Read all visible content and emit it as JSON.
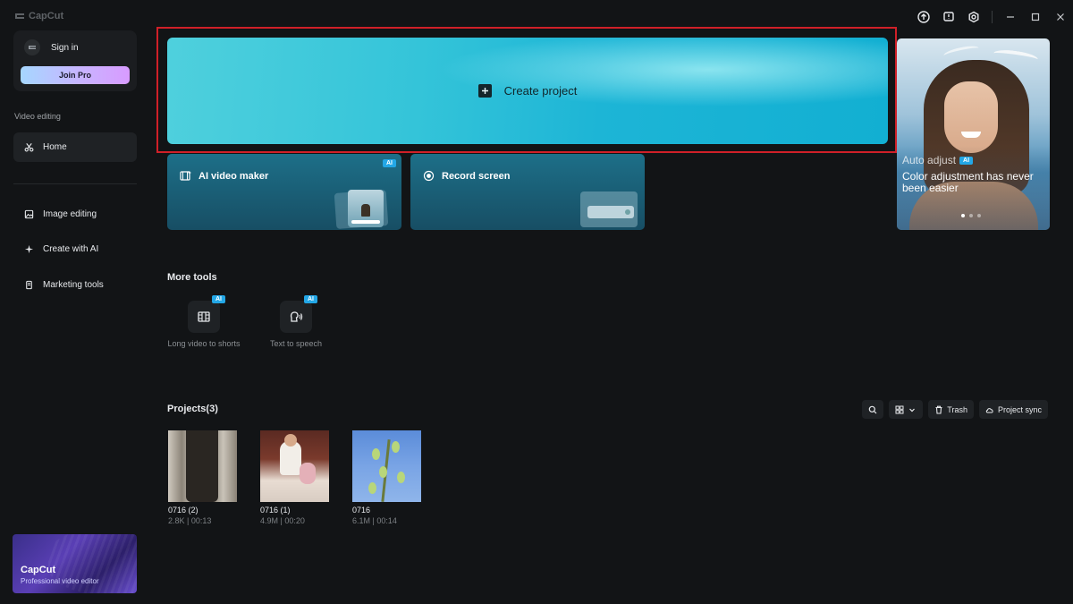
{
  "app": {
    "name": "CapCut"
  },
  "sidebar": {
    "sign_in": "Sign in",
    "join_pro": "Join Pro",
    "section_label": "Video editing",
    "home": "Home",
    "items": [
      {
        "label": "Image editing",
        "icon": "image-icon"
      },
      {
        "label": "Create with AI",
        "icon": "sparkle-icon"
      },
      {
        "label": "Marketing tools",
        "icon": "marketing-icon"
      }
    ],
    "promo": {
      "title": "CapCut",
      "subtitle": "Professional video editor"
    }
  },
  "main": {
    "create_project": "Create project",
    "tool_cards": [
      {
        "label": "AI video maker",
        "badge": "AI",
        "icon": "film-ai-icon"
      },
      {
        "label": "Record screen",
        "icon": "record-icon"
      }
    ],
    "hero": {
      "kicker": "Auto adjust",
      "badge": "AI",
      "title": "Color adjustment has never been easier",
      "slides": 3,
      "active_slide": 1
    },
    "more_tools": {
      "title": "More tools",
      "items": [
        {
          "label": "Long video to shorts",
          "badge": "AI",
          "icon": "film-cut-icon"
        },
        {
          "label": "Text to speech",
          "badge": "AI",
          "icon": "speech-icon"
        }
      ]
    },
    "projects": {
      "title": "Projects(3)",
      "actions": {
        "trash": "Trash",
        "sync": "Project sync"
      },
      "items": [
        {
          "name": "0716 (2)",
          "meta": "2.8K | 00:13"
        },
        {
          "name": "0716 (1)",
          "meta": "4.9M | 00:20"
        },
        {
          "name": "0716",
          "meta": "6.1M | 00:14"
        }
      ]
    }
  },
  "colors": {
    "background": "#121416",
    "accent_cyan": "#1db5d6",
    "highlight_border": "#d02028",
    "ai_badge": "#23a7e6"
  }
}
